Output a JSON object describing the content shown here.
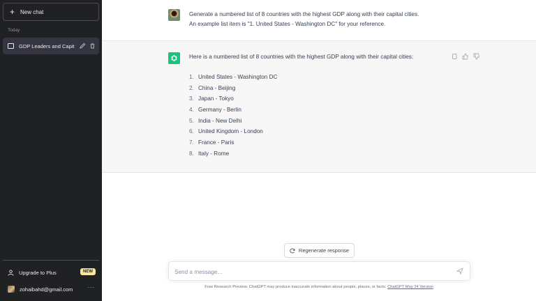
{
  "sidebar": {
    "new_chat_label": "New chat",
    "section_label": "Today",
    "chat_title": "GDP Leaders and Capit",
    "upgrade_label": "Upgrade to Plus",
    "new_badge": "NEW",
    "account_email": "zohaibahd@gmail.com",
    "more_label": "···"
  },
  "conversation": {
    "user_message_line1": "Generate a numbered list of 8 countries with the highest GDP along with their capital cities.",
    "user_message_line2": "An example list item is \"1. United States - Washington DC\" for your reference.",
    "assistant_intro": "Here is a numbered list of 8 countries with the highest GDP along with their capital cities:",
    "list": [
      {
        "num": "1.",
        "text": "United States - Washington DC"
      },
      {
        "num": "2.",
        "text": "China - Beijing"
      },
      {
        "num": "3.",
        "text": "Japan - Tokyo"
      },
      {
        "num": "4.",
        "text": "Germany - Berlin"
      },
      {
        "num": "5.",
        "text": "India - New Delhi"
      },
      {
        "num": "6.",
        "text": "United Kingdom - London"
      },
      {
        "num": "7.",
        "text": "France - Paris"
      },
      {
        "num": "8.",
        "text": "Italy - Rome"
      }
    ]
  },
  "composer": {
    "regenerate_label": "Regenerate response",
    "placeholder": "Send a message..."
  },
  "footer": {
    "text": "Free Research Preview. ChatGPT may produce inaccurate information about people, places, or facts. ",
    "link": "ChatGPT May 24 Version"
  },
  "colors": {
    "sidebar_bg": "#202123",
    "active_chat_bg": "#343541",
    "assistant_bg": "#f7f7f8",
    "brand_green": "#19c37d",
    "badge_yellow": "#fae69e"
  },
  "icons": [
    "plus-icon",
    "message-icon",
    "edit-icon",
    "trash-icon",
    "user-icon",
    "chatgpt-logo-icon",
    "copy-icon",
    "thumbs-up-icon",
    "thumbs-down-icon",
    "refresh-icon",
    "send-icon"
  ]
}
